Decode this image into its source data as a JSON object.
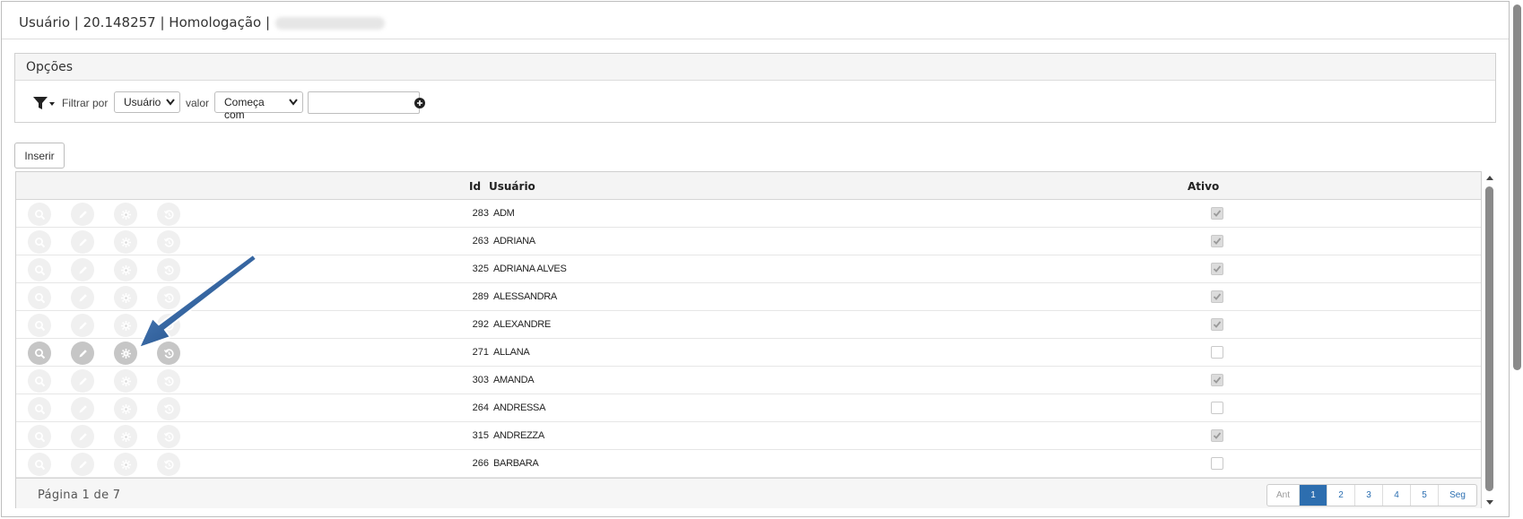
{
  "header": {
    "title": "Usuário | 20.148257 | Homologação |"
  },
  "options": {
    "title": "Opções",
    "filter_by_label": "Filtrar por",
    "field_select": "Usuário",
    "value_label": "valor",
    "operator_select": "Começa com",
    "value_input": ""
  },
  "toolbar": {
    "insert_label": "Inserir"
  },
  "grid": {
    "columns": {
      "id": "Id",
      "user": "Usuário",
      "active": "Ativo"
    },
    "rows": [
      {
        "id": "283",
        "user": "ADM",
        "active": true
      },
      {
        "id": "263",
        "user": "ADRIANA",
        "active": true
      },
      {
        "id": "325",
        "user": "ADRIANA ALVES",
        "active": true
      },
      {
        "id": "289",
        "user": "ALESSANDRA",
        "active": true
      },
      {
        "id": "292",
        "user": "ALEXANDRE",
        "active": true
      },
      {
        "id": "271",
        "user": "ALLANA",
        "active": false,
        "highlighted": true
      },
      {
        "id": "303",
        "user": "AMANDA",
        "active": true
      },
      {
        "id": "264",
        "user": "ANDRESSA",
        "active": false
      },
      {
        "id": "315",
        "user": "ANDREZZA",
        "active": true
      },
      {
        "id": "266",
        "user": "BARBARA",
        "active": false
      }
    ],
    "row_action_icons": [
      "search-icon",
      "pencil-icon",
      "gear-icon",
      "history-icon"
    ]
  },
  "footer": {
    "page_info": "Página 1 de 7",
    "pager": {
      "prev": "Ant",
      "pages": [
        "1",
        "2",
        "3",
        "4",
        "5"
      ],
      "next": "Seg",
      "current": "1"
    }
  },
  "colors": {
    "accent": "#2d6eaf",
    "annotation_arrow": "#1f4f8a"
  }
}
